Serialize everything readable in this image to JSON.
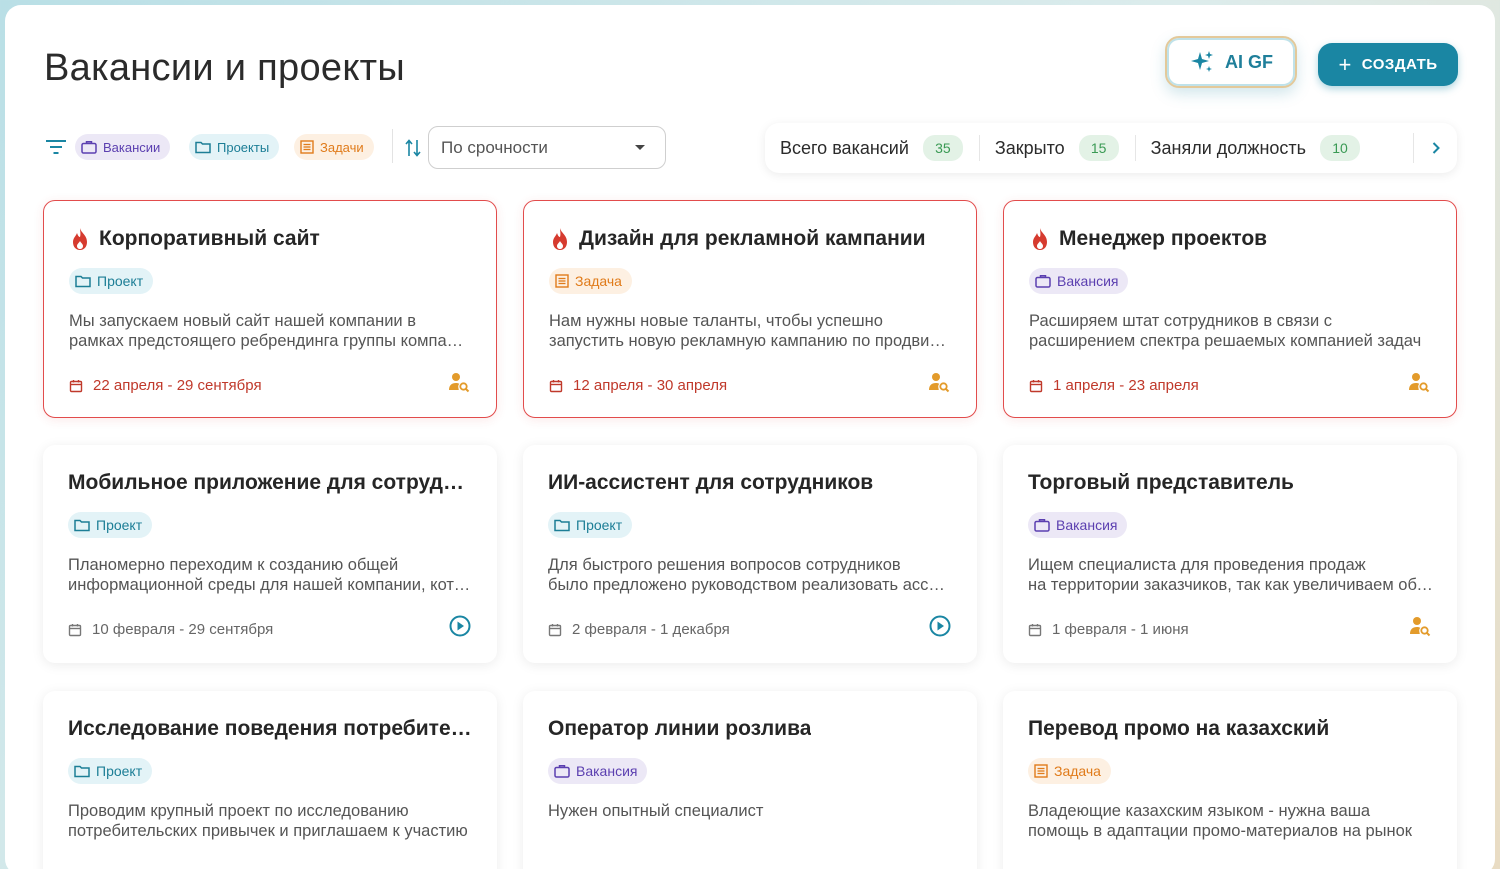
{
  "header": {
    "title": "Вакансии и проекты",
    "ai_button": "AI GF",
    "create_button": "СОЗДАТЬ"
  },
  "filters": {
    "chips": [
      "Вакансии",
      "Проекты",
      "Задачи"
    ],
    "sort_value": "По срочности"
  },
  "stats": [
    {
      "label": "Всего вакансий",
      "value": "35"
    },
    {
      "label": "Закрыто",
      "value": "15"
    },
    {
      "label": "Заняли должность",
      "value": "10"
    }
  ],
  "cards": [
    {
      "title": "Корпоративный сайт",
      "urgent": true,
      "type": "Проект",
      "kind": "proj",
      "desc1": "Мы запускаем новый сайт нашей компании в",
      "desc2": "рамках предстоящего ребрендинга группы компаний",
      "date": "22 апреля - 29 сентября",
      "action": "person-search-icon"
    },
    {
      "title": "Дизайн для рекламной кампании",
      "urgent": true,
      "type": "Задача",
      "kind": "task",
      "desc1": "Нам нужны новые таланты, чтобы успешно",
      "desc2": "запустить новую рекламную кампанию по продвижению",
      "date": "12 апреля - 30 апреля",
      "action": "person-search-icon"
    },
    {
      "title": "Менеджер проектов",
      "urgent": true,
      "type": "Вакансия",
      "kind": "vac",
      "desc1": "Расширяем штат сотрудников в связи с",
      "desc2": "расширением спектра решаемых компанией задач",
      "date": "1 апреля - 23 апреля",
      "action": "person-search-icon"
    },
    {
      "title": "Мобильное приложение для сотрудников",
      "urgent": false,
      "type": "Проект",
      "kind": "proj",
      "desc1": "Планомерно переходим к созданию общей",
      "desc2": "информационной среды для нашей компании, которая",
      "date": "10 февраля -  29 сентября",
      "action": "play-icon"
    },
    {
      "title": "ИИ-ассистент для сотрудников",
      "urgent": false,
      "type": "Проект",
      "kind": "proj",
      "desc1": "Для быстрого решения вопросов сотрудников",
      "desc2": "было предложено руководством реализовать ассистента",
      "date": "2 февраля - 1 декабря",
      "action": "play-icon"
    },
    {
      "title": "Торговый представитель",
      "urgent": false,
      "type": "Вакансия",
      "kind": "vac",
      "desc1": "Ищем специалиста для проведения продаж",
      "desc2": "на территории заказчиков, так как увеличиваем объёмы",
      "date": "1 февраля - 1 июня",
      "action": "person-search-icon"
    },
    {
      "title": "Исследование поведения потребителей",
      "urgent": false,
      "type": "Проект",
      "kind": "proj",
      "desc1": "Проводим крупный проект по исследованию",
      "desc2": "потребительских привычек и приглашаем к участию",
      "date": "",
      "action": ""
    },
    {
      "title": "Оператор линии розлива",
      "urgent": false,
      "type": "Вакансия",
      "kind": "vac",
      "desc1": "Нужен опытный специалист",
      "desc2": "",
      "date": "",
      "action": ""
    },
    {
      "title": "Перевод промо на казахский",
      "urgent": false,
      "type": "Задача",
      "kind": "task",
      "desc1": "Владеющие казахским языком - нужна ваша",
      "desc2": "помощь в адаптации промо-материалов на рынок",
      "date": "",
      "action": ""
    }
  ]
}
